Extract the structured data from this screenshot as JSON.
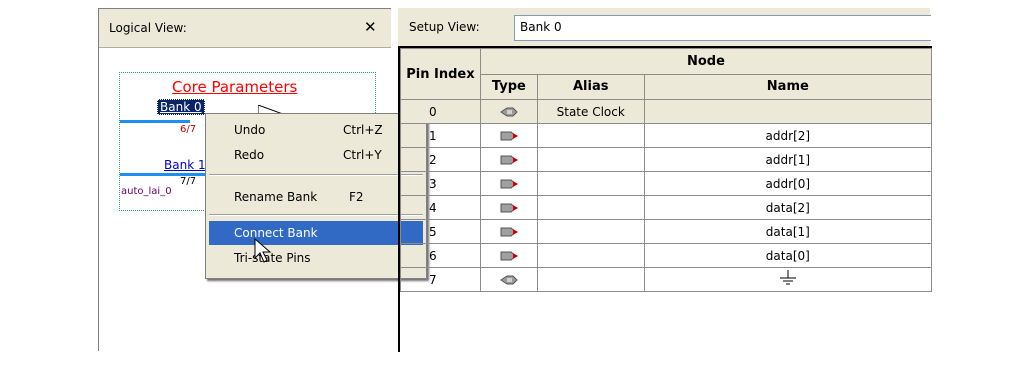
{
  "logical_view": {
    "title": "Logical View:",
    "close_symbol": "✕",
    "core_parameters_label": "Core Parameters",
    "bank0_label": "Bank 0",
    "bank0_ratio": "6/7",
    "bank1_label": "Bank 1",
    "bank1_ratio": "7/7",
    "instance_label": "auto_lai_0"
  },
  "context_menu": {
    "items": [
      {
        "label": "Undo",
        "shortcut": "Ctrl+Z"
      },
      {
        "label": "Redo",
        "shortcut": "Ctrl+Y"
      },
      {
        "label": "Rename Bank",
        "shortcut": "F2"
      },
      {
        "label": "Connect Bank",
        "shortcut": "",
        "highlighted": true
      },
      {
        "label": "Tri-state Pins",
        "shortcut": ""
      }
    ]
  },
  "setup_view": {
    "label": "Setup View:",
    "bank_value": "Bank 0"
  },
  "table": {
    "headers": {
      "pin_index": "Pin Index",
      "node": "Node",
      "type": "Type",
      "alias": "Alias",
      "name": "Name"
    },
    "rows": [
      {
        "index": "0",
        "type_icon": "clock-pin-icon",
        "alias": "State Clock",
        "name": ""
      },
      {
        "index": "1",
        "type_icon": "input-pin-icon",
        "alias": "",
        "name": "addr[2]"
      },
      {
        "index": "2",
        "type_icon": "input-pin-icon",
        "alias": "",
        "name": "addr[1]"
      },
      {
        "index": "3",
        "type_icon": "input-pin-icon",
        "alias": "",
        "name": "addr[0]"
      },
      {
        "index": "4",
        "type_icon": "input-pin-icon",
        "alias": "",
        "name": "data[2]"
      },
      {
        "index": "5",
        "type_icon": "input-pin-icon",
        "alias": "",
        "name": "data[1]"
      },
      {
        "index": "6",
        "type_icon": "input-pin-icon",
        "alias": "",
        "name": "data[0]"
      },
      {
        "index": "7",
        "type_icon": "clock-pin-icon",
        "alias": "",
        "name": "",
        "name_icon": "ground-icon"
      }
    ]
  },
  "colors": {
    "chrome": "#ece9d8",
    "selection": "#316ac5",
    "core_title": "#ff0000",
    "bank_line": "#1e8ef0"
  }
}
